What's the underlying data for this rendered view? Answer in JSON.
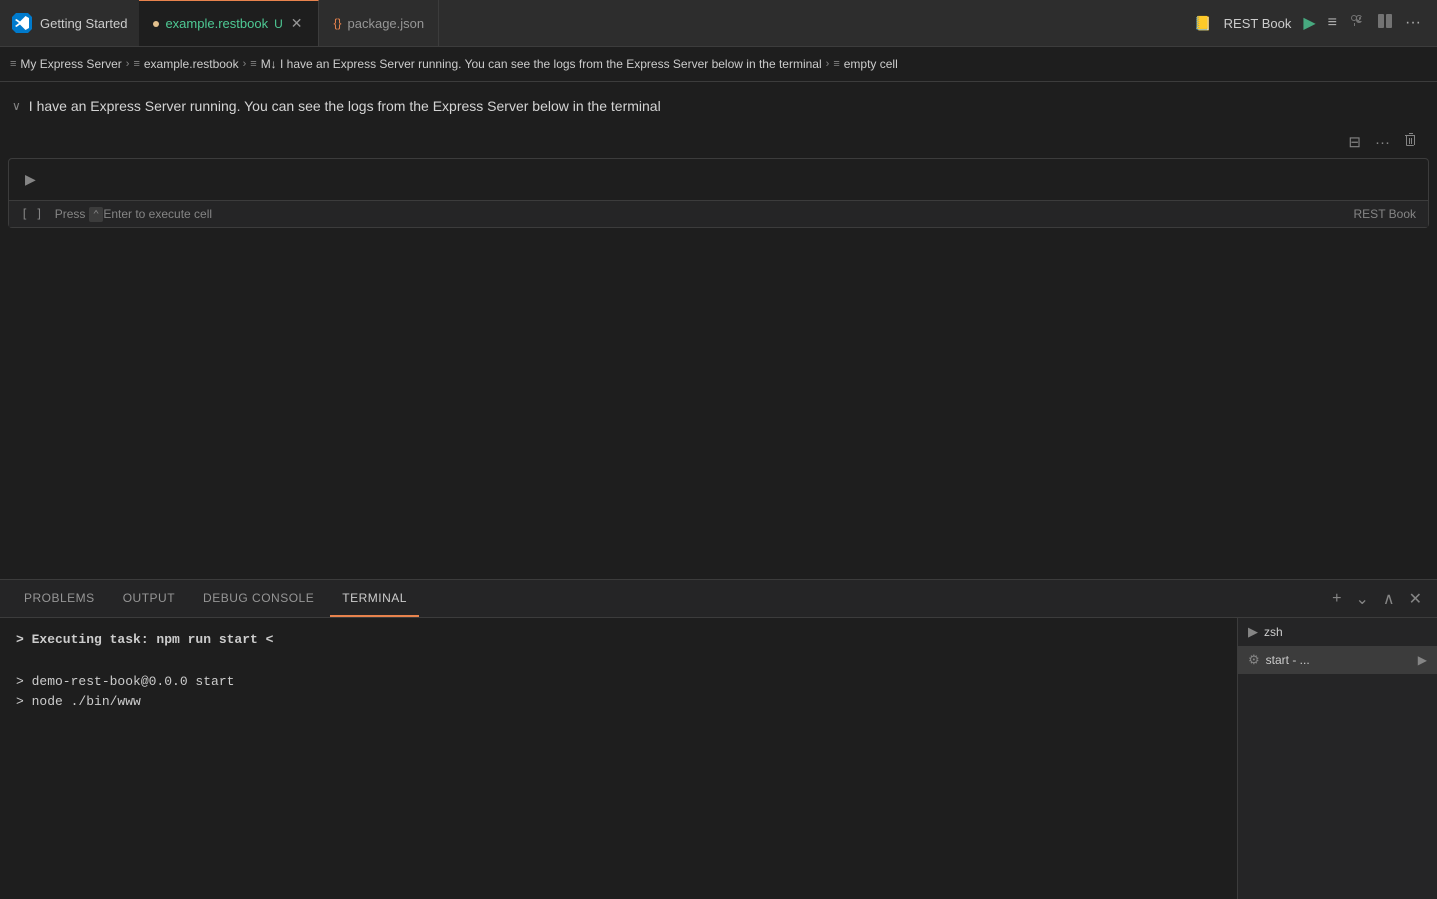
{
  "titlebar": {
    "getting_started": "Getting Started",
    "tab1_icon": "≡",
    "tab1_label": "example.restbook",
    "tab1_modified": "U",
    "tab2_icon": "{}",
    "tab2_label": "package.json",
    "run_label": "REST Book",
    "icon_run": "▶",
    "icon_list": "≡",
    "icon_branch": "⑂",
    "icon_layout": "⊞",
    "icon_more": "···"
  },
  "breadcrumb": {
    "item1": "My Express Server",
    "item2": "example.restbook",
    "item3": "M↓ I have an Express Server running. You can see the logs from the Express Server below in the terminal",
    "item4": "empty cell"
  },
  "notebook": {
    "section_title": "I have an Express Server running. You can see the logs from the Express Server below in the terminal",
    "cell": {
      "hint": "Press ⌃Enter to execute cell",
      "number": "[ ]",
      "footer_label": "REST Book"
    },
    "toolbar": {
      "split_icon": "⊟",
      "more_icon": "···",
      "delete_icon": "🗑"
    }
  },
  "panel": {
    "tabs": [
      "PROBLEMS",
      "OUTPUT",
      "DEBUG CONSOLE",
      "TERMINAL"
    ],
    "active_tab": "TERMINAL",
    "terminal_content": [
      "> Executing task: npm run start <",
      "",
      "> demo-rest-book@0.0.0 start",
      "> node ./bin/www"
    ],
    "sidebar": {
      "items": [
        {
          "icon": "▶",
          "label": "zsh",
          "type": "shell"
        },
        {
          "icon": "⚙",
          "label": "start - ...",
          "type": "task",
          "run": "▶"
        }
      ]
    },
    "actions": {
      "add": "+",
      "chevron": "⌄",
      "maximize": "∧",
      "close": "✕"
    }
  }
}
